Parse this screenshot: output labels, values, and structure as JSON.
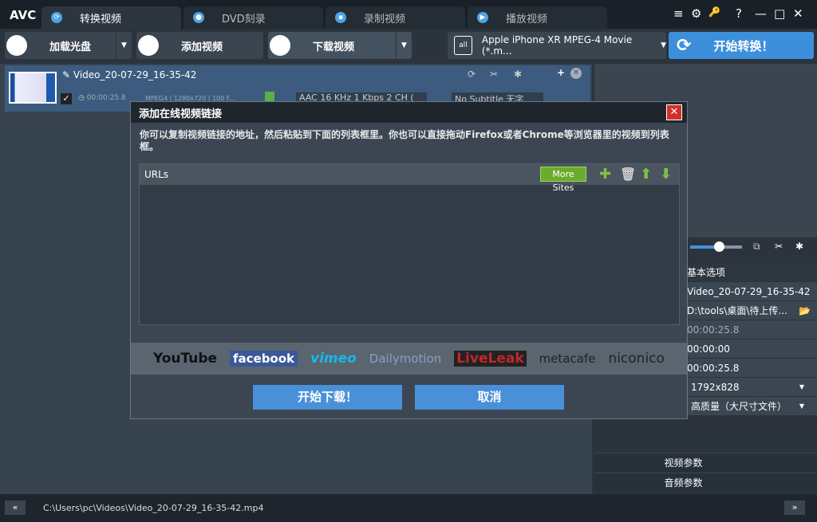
{
  "app": {
    "logo": "AVC",
    "tabs": [
      {
        "label": "转换视频",
        "active": true
      },
      {
        "label": "DVD刻录"
      },
      {
        "label": "录制视频"
      },
      {
        "label": "播放视频"
      }
    ],
    "window_controls": [
      "≡",
      "⚙",
      "🔑",
      "?",
      "—",
      "□",
      "✕"
    ]
  },
  "toolbar": {
    "load_disc": "加载光盘",
    "add_video": "添加视频",
    "download_video": "下载视频",
    "profile": "Apple iPhone XR MPEG-4 Movie (*.m...",
    "profile_icon": "all",
    "start": "开始转换！"
  },
  "item": {
    "name": "Video_20-07-29_16-35-42",
    "duration": "00:00:25.8",
    "video_info": "MPEG4 | 1280x720 | 100 F...",
    "audio": "AAC 16 KHz 1 Kbps 2 CH (",
    "subtitle": "No Subtitle 无字"
  },
  "right": {
    "basic_options": "基本选项",
    "filename": "Video_20-07-29_16-35-42",
    "output_dir": "D:\\tools\\桌面\\待上传...",
    "duration": "00:00:25.8",
    "start": "00:00:00",
    "end": "00:00:25.8",
    "size": "1792x828",
    "quality": "高质量（大尺寸文件）",
    "video_params": "视频参数",
    "audio_params": "音频参数",
    "slider_value": 0.55
  },
  "status": {
    "path": "C:\\Users\\pc\\Videos\\Video_20-07-29_16-35-42.mp4"
  },
  "dialog": {
    "title": "添加在线视频链接",
    "description": "你可以复制视频链接的地址，然后粘贴到下面的列表框里。你也可以直接拖动Firefox或者Chrome等浏览器里的视频到列表框。",
    "urls_header": "URLs",
    "more_sites": "More Sites",
    "logos": [
      "YouTube",
      "facebook",
      "vimeo",
      "Dailymotion",
      "LiveLeak",
      "metacafe",
      "niconico"
    ],
    "start_download": "开始下载！",
    "cancel": "取消"
  }
}
